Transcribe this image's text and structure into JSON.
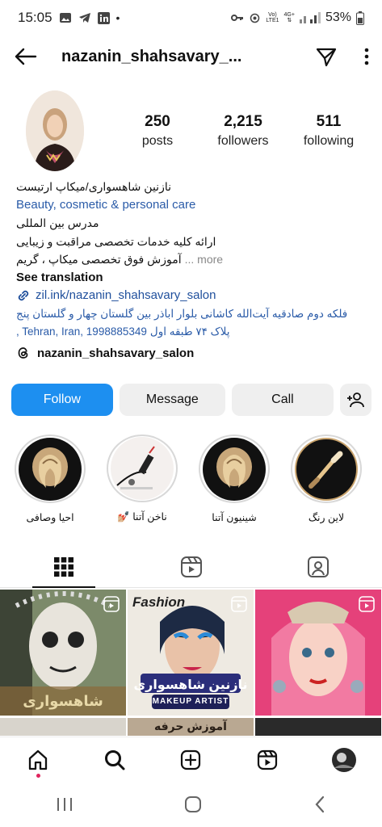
{
  "status": {
    "time": "15:05",
    "battery": "53%",
    "net_top": "Vo)",
    "net_bottom": "LTE1",
    "gen": "4G+"
  },
  "header": {
    "username": "nazanin_shahsavary_..."
  },
  "profile": {
    "stats": [
      {
        "value": "250",
        "label": "posts"
      },
      {
        "value": "2,215",
        "label": "followers"
      },
      {
        "value": "511",
        "label": "following"
      }
    ],
    "bio": {
      "name_line": "نازنین شاهسواری/میکاپ ارتیست",
      "category": "Beauty, cosmetic & personal care",
      "line1": "مدرس بین المللی",
      "line2": "ارائه کلیه خدمات تخصصی مراقبت و زیبایی",
      "line3": "آموزش فوق تخصصی میکاپ ، گریم",
      "more": "... more",
      "see_translation": "See translation",
      "link": "zil.ink/nazanin_shahsavary_salon",
      "address1": "فلکه دوم صادقیه آیت‌الله کاشانی بلوار اباذر بین گلستان چهار و گلستان پنج",
      "address2": "پلاک ۷۴ طبقه اول",
      "address2_tail": ", Tehran, Iran, 1998885349"
    },
    "threads_handle": "nazanin_shahsavary_salon"
  },
  "actions": {
    "follow": "Follow",
    "message": "Message",
    "call": "Call"
  },
  "highlights": [
    {
      "label": "احیا وصافی"
    },
    {
      "label": "ناخن آتنا 💅🏼"
    },
    {
      "label": "شینیون آتنا"
    },
    {
      "label": "لاین رنگ"
    }
  ],
  "grid": {
    "cell2_top": "Fashion",
    "cell2_name": "نازنین شاهسواری",
    "cell2_sub": "MAKEUP ARTIST",
    "cell1_text": "شاهسواری",
    "row2_text": "آموزش حرفه"
  },
  "colors": {
    "accent": "#1d8ff0",
    "link": "#2a5ba8",
    "notify_dot": "#e0245e"
  },
  "icons": [
    "back-arrow-icon",
    "send-icon",
    "more-vertical-icon",
    "link-icon",
    "threads-icon",
    "add-person-icon",
    "grid-icon",
    "reels-icon",
    "tagged-icon",
    "home-icon",
    "search-icon",
    "create-icon",
    "reels-nav-icon",
    "profile-icon"
  ]
}
